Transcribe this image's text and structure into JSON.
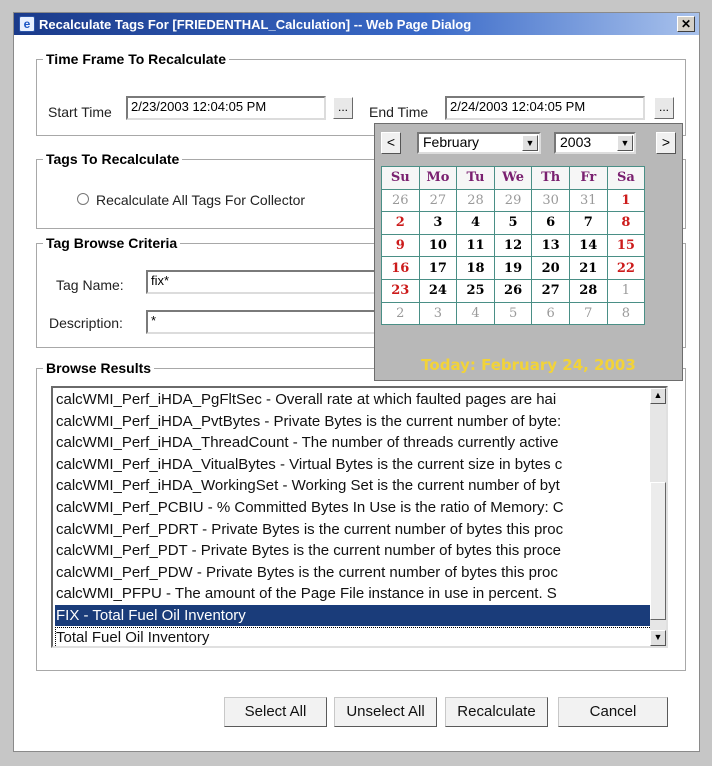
{
  "window": {
    "title": "Recalculate Tags For [FRIEDENTHAL_Calculation] -- Web Page Dialog",
    "close_glyph": "✕"
  },
  "time_frame": {
    "legend": "Time Frame To Recalculate",
    "start_label": "Start Time",
    "start_value": "2/23/2003 12:04:05 PM",
    "end_label": "End Time",
    "end_value": "2/24/2003 12:04:05 PM",
    "picker_label": "..."
  },
  "tags_to_recalc": {
    "legend": "Tags To Recalculate",
    "option_label": "Recalculate All Tags For Collector"
  },
  "browse_criteria": {
    "legend": "Tag Browse Criteria",
    "tag_name_label": "Tag Name:",
    "tag_name_value": "fix*",
    "description_label": "Description:",
    "description_value": "*"
  },
  "calendar": {
    "prev": "<",
    "next": ">",
    "month": "February",
    "year": "2003",
    "weekdays": [
      "Su",
      "Mo",
      "Tu",
      "We",
      "Th",
      "Fr",
      "Sa"
    ],
    "weeks": [
      [
        "26",
        "27",
        "28",
        "29",
        "30",
        "31",
        "1"
      ],
      [
        "2",
        "3",
        "4",
        "5",
        "6",
        "7",
        "8"
      ],
      [
        "9",
        "10",
        "11",
        "12",
        "13",
        "14",
        "15"
      ],
      [
        "16",
        "17",
        "18",
        "19",
        "20",
        "21",
        "22"
      ],
      [
        "23",
        "24",
        "25",
        "26",
        "27",
        "28",
        "1"
      ],
      [
        "2",
        "3",
        "4",
        "5",
        "6",
        "7",
        "8"
      ]
    ],
    "today": "Today: February 24, 2003"
  },
  "browse_results": {
    "legend": "Browse Results",
    "items": [
      "calcWMI_Perf_iHDA_PgFltSec - Overall rate at which faulted pages are hai",
      "calcWMI_Perf_iHDA_PvtBytes - Private Bytes is the current number of byte:",
      "calcWMI_Perf_iHDA_ThreadCount - The number of threads currently active",
      "calcWMI_Perf_iHDA_VitualBytes - Virtual Bytes is the current size in bytes c",
      "calcWMI_Perf_iHDA_WorkingSet - Working Set is the current number of byt",
      "calcWMI_Perf_PCBIU - % Committed Bytes In Use is the ratio of Memory: C",
      "calcWMI_Perf_PDRT - Private Bytes is the current number of bytes this proc",
      "calcWMI_Perf_PDT - Private Bytes is the current number of bytes this proce",
      "calcWMI_Perf_PDW - Private Bytes is the current number of bytes this proc",
      "calcWMI_PFPU - The amount of the Page File instance in use in percent. S",
      "FIX - Total Fuel Oil Inventory",
      "Total Fuel Oil Inventory"
    ],
    "selected_index": 10
  },
  "buttons": {
    "select_all": "Select All",
    "unselect_all": "Unselect All",
    "recalculate": "Recalculate",
    "cancel": "Cancel"
  },
  "colors": {
    "selection": "#1a3c7a",
    "weekend": "#cc1b1b",
    "today": "#f2d338",
    "calendar_border": "#4a8f86"
  }
}
